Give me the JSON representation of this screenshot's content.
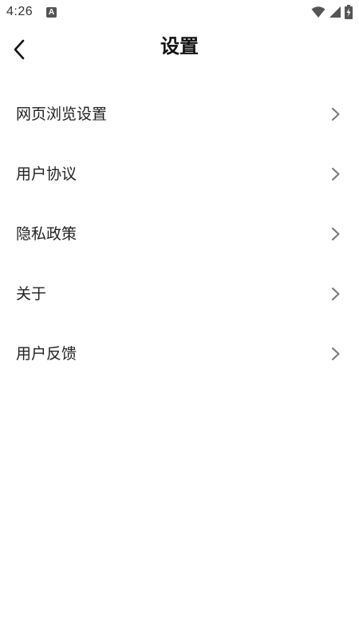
{
  "status_bar": {
    "time": "4:26",
    "notification_icon": "A",
    "icons": [
      "wifi-icon",
      "signal-icon",
      "battery-charging-icon"
    ]
  },
  "header": {
    "title": "设置",
    "back_icon": "chevron-left-icon"
  },
  "menu": {
    "items": [
      {
        "label": "网页浏览设置",
        "icon": "chevron-right-icon"
      },
      {
        "label": "用户协议",
        "icon": "chevron-right-icon"
      },
      {
        "label": "隐私政策",
        "icon": "chevron-right-icon"
      },
      {
        "label": "关于",
        "icon": "chevron-right-icon"
      },
      {
        "label": "用户反馈",
        "icon": "chevron-right-icon"
      }
    ]
  },
  "colors": {
    "background": "#ffffff",
    "text": "#222222",
    "chevron": "#777777"
  }
}
